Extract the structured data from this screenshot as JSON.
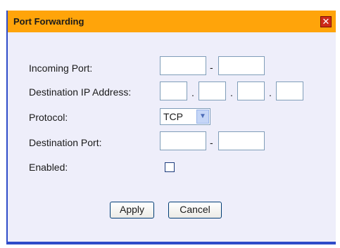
{
  "dialog": {
    "title": "Port Forwarding",
    "close_symbol": "✕"
  },
  "form": {
    "incoming_port_label": "Incoming Port:",
    "incoming_port_start": "",
    "incoming_port_end": "",
    "range_separator": "-",
    "destination_ip_label": "Destination IP Address:",
    "ip_octets": [
      "",
      "",
      "",
      ""
    ],
    "ip_separator": ".",
    "protocol_label": "Protocol:",
    "protocol_value": "TCP",
    "destination_port_label": "Destination Port:",
    "destination_port_start": "",
    "destination_port_end": "",
    "enabled_label": "Enabled:",
    "enabled": false
  },
  "buttons": {
    "apply": "Apply",
    "cancel": "Cancel"
  },
  "colors": {
    "titlebar": "#ffa40a",
    "dialog_background": "#eeeefa",
    "border": "#2f4cc9",
    "close_button": "#cc2a1a"
  },
  "icons": {
    "close": "close-icon",
    "dropdown": "chevron-down-icon"
  }
}
